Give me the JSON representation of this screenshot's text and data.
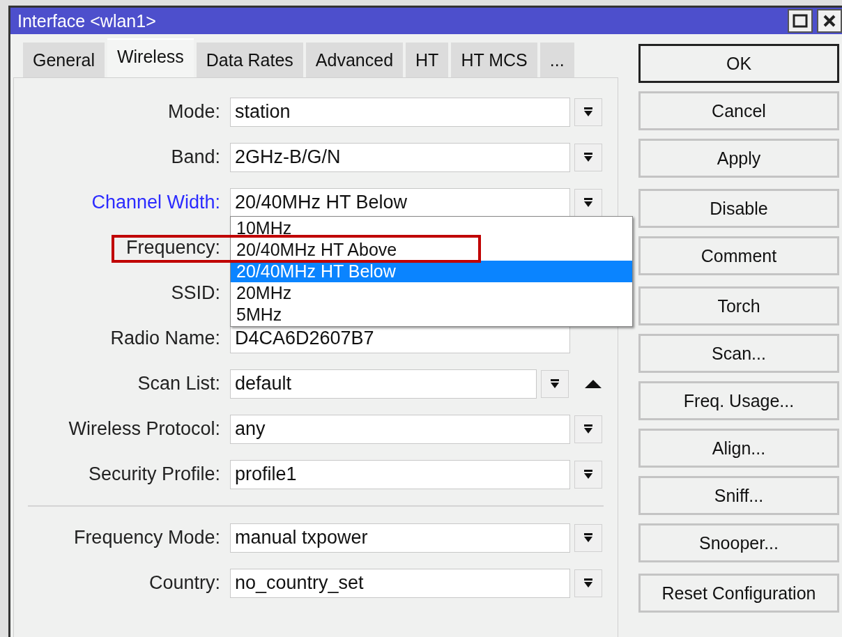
{
  "window": {
    "title": "Interface <wlan1>"
  },
  "tabs": [
    {
      "label": "General",
      "selected": false
    },
    {
      "label": "Wireless",
      "selected": true
    },
    {
      "label": "Data Rates",
      "selected": false
    },
    {
      "label": "Advanced",
      "selected": false
    },
    {
      "label": "HT",
      "selected": false
    },
    {
      "label": "HT MCS",
      "selected": false
    },
    {
      "label": "...",
      "selected": false
    }
  ],
  "sections": [
    [
      {
        "label": "Mode:",
        "value": "station",
        "kind": "dropdown",
        "changed": false
      },
      {
        "label": "Band:",
        "value": "2GHz-B/G/N",
        "kind": "dropdown",
        "changed": false
      },
      {
        "label": "Channel Width:",
        "value": "20/40MHz HT Below",
        "kind": "dropdown",
        "changed": true,
        "open": true,
        "options": [
          {
            "label": "10MHz",
            "selected": false
          },
          {
            "label": "20/40MHz HT Above",
            "selected": false
          },
          {
            "label": "20/40MHz HT Below",
            "selected": true
          },
          {
            "label": "20MHz",
            "selected": false
          },
          {
            "label": "5MHz",
            "selected": false
          }
        ]
      },
      {
        "label": "Frequency:",
        "kind": "text",
        "changed": false
      },
      {
        "label": "SSID:",
        "kind": "text",
        "changed": false
      },
      {
        "label": "Radio Name:",
        "value": "D4CA6D2607B7",
        "kind": "text",
        "changed": false
      },
      {
        "label": "Scan List:",
        "value": "default",
        "kind": "scanlist",
        "changed": false
      },
      {
        "label": "Wireless Protocol:",
        "value": "any",
        "kind": "dropdown",
        "changed": false
      },
      {
        "label": "Security Profile:",
        "value": "profile1",
        "kind": "dropdown",
        "changed": false
      }
    ],
    [
      {
        "label": "Frequency Mode:",
        "value": "manual txpower",
        "kind": "dropdown",
        "changed": false
      },
      {
        "label": "Country:",
        "value": "no_country_set",
        "kind": "dropdown",
        "changed": false
      }
    ]
  ],
  "button_groups": [
    [
      {
        "label": "OK",
        "default": true
      },
      {
        "label": "Cancel",
        "default": false
      },
      {
        "label": "Apply",
        "default": false
      }
    ],
    [
      {
        "label": "Disable",
        "default": false
      },
      {
        "label": "Comment",
        "default": false
      }
    ],
    [
      {
        "label": "Torch",
        "default": false
      },
      {
        "label": "Scan...",
        "default": false
      },
      {
        "label": "Freq. Usage...",
        "default": false
      },
      {
        "label": "Align...",
        "default": false
      },
      {
        "label": "Sniff...",
        "default": false
      },
      {
        "label": "Snooper...",
        "default": false
      }
    ],
    [
      {
        "label": "Reset Configuration",
        "default": false
      }
    ]
  ]
}
